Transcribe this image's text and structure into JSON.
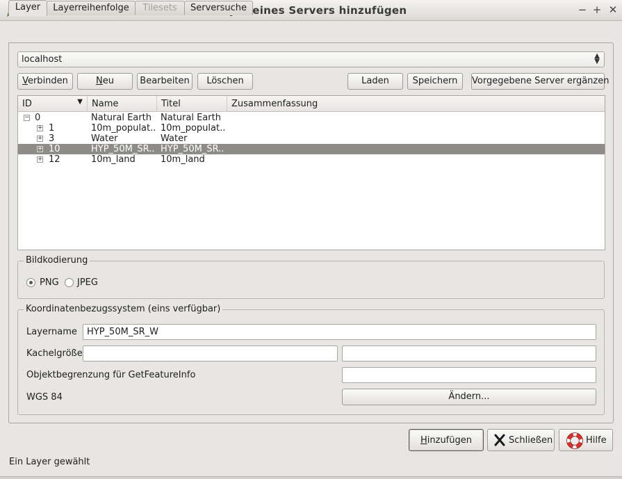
{
  "window": {
    "title": "Layer eines Servers hinzufügen",
    "controls": [
      "−",
      "+",
      "✕"
    ]
  },
  "tabs": [
    {
      "label": "Layer",
      "active": true
    },
    {
      "label": "Layerreihenfolge"
    },
    {
      "label": "Tilesets",
      "disabled": true
    },
    {
      "label": "Serversuche"
    }
  ],
  "connection": {
    "selected": "localhost"
  },
  "buttons": {
    "connect_pre": "",
    "connect_key": "V",
    "connect_rest": "erbinden",
    "new_pre": "",
    "new_key": "N",
    "new_rest": "eu",
    "edit": "Bearbeiten",
    "delete": "Löschen",
    "load": "Laden",
    "save": "Speichern",
    "add_default": "Vorgegebene Server ergänzen"
  },
  "tree": {
    "columns": [
      "ID",
      "Name",
      "Titel",
      "Zusammenfassung"
    ],
    "rows": [
      {
        "id": "0",
        "name": "Natural Earth",
        "title": "Natural Earth",
        "summary": "",
        "level": 0,
        "expander": "−"
      },
      {
        "id": "1",
        "name": "10m_populat...",
        "title": "10m_populat...",
        "summary": "",
        "level": 1,
        "expander": "+"
      },
      {
        "id": "3",
        "name": "Water",
        "title": "Water",
        "summary": "",
        "level": 1,
        "expander": "+"
      },
      {
        "id": "10",
        "name": "HYP_50M_SR...",
        "title": "HYP_50M_SR...",
        "summary": "",
        "level": 1,
        "expander": "+",
        "selected": true
      },
      {
        "id": "12",
        "name": "10m_land",
        "title": "10m_land",
        "summary": "",
        "level": 1,
        "expander": "+"
      }
    ]
  },
  "encoding": {
    "group_title": "Bildkodierung",
    "options": [
      {
        "label": "PNG",
        "checked": true
      },
      {
        "label": "JPEG",
        "checked": false
      }
    ]
  },
  "crs": {
    "group_title": "Koordinatenbezugssystem (eins verfügbar)",
    "layername_label": "Layername",
    "layername_value": "HYP_50M_SR_W",
    "tilesize_label": "Kachelgröße",
    "tilesize_width": "",
    "tilesize_height": "",
    "featureinfo_label": "Objektbegrenzung für GetFeatureInfo",
    "featureinfo_value": "",
    "crs_name": "WGS 84",
    "change_button": "Ändern..."
  },
  "footer": {
    "add_pre": "",
    "add_key": "H",
    "add_rest": "inzufügen",
    "close": "Schließen",
    "help": "Hilfe"
  },
  "status": "Ein Layer gewählt",
  "colors": {
    "selection": "#8e8c86",
    "window_bg": "#e8e6e3",
    "close_icon": "#1a1a1a",
    "help_icon": "#d9302c"
  }
}
